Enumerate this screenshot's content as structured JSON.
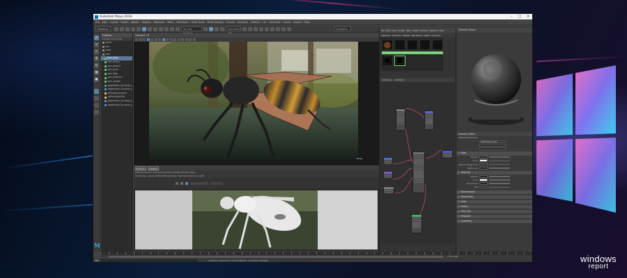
{
  "window": {
    "title": "Autodesk Maya 2018",
    "controls": [
      "–",
      "□",
      "✕"
    ]
  },
  "menubar": [
    "File",
    "Edit",
    "Create",
    "Select",
    "Modify",
    "Display",
    "Windows",
    "Mesh",
    "Edit Mesh",
    "Mesh Tools",
    "Mesh Display",
    "Curves",
    "Surfaces",
    "Deform",
    "UV",
    "Generate",
    "Cache",
    "Arnold",
    "Help"
  ],
  "shelf": {
    "mode": "Modeling",
    "symmetry": "No Live Surface",
    "field_a": "Symmetry: Off",
    "field_b": "Autodesk"
  },
  "outliner": {
    "title": "Outliner",
    "menu": "Display  Show  Help",
    "items": [
      {
        "label": "persp",
        "color": "#8a8a8a"
      },
      {
        "label": "top",
        "color": "#8a8a8a"
      },
      {
        "label": "front",
        "color": "#8a8a8a"
      },
      {
        "label": "side",
        "color": "#8a8a8a"
      },
      {
        "label": "bee_body",
        "color": "#6fbf6f"
      },
      {
        "label": "bee_wing_L",
        "color": "#6fbf6f"
      },
      {
        "label": "bee_wing_R",
        "color": "#6fbf6f"
      },
      {
        "label": "bee_eyes",
        "color": "#6fbf6f"
      },
      {
        "label": "bee_legs",
        "color": "#6fbf6f"
      },
      {
        "label": "bee_antenna",
        "color": "#6fbf6f"
      },
      {
        "label": "bee_stinger",
        "color": "#6fbf6f"
      },
      {
        "label": "Vegetation_Surfaces_grp",
        "color": "#5a8fd0"
      },
      {
        "label": "Vegetation_Surfaces_grp1",
        "color": "#5a8fd0"
      },
      {
        "label": "aiSkyDomeLight1",
        "color": "#d0c25a"
      },
      {
        "label": "defaultLightSet",
        "color": "#d0c25a"
      },
      {
        "label": "Vegetation_Surfaces_grp2",
        "color": "#5a8fd0"
      },
      {
        "label": "Vegetation_Surfaces_grp3",
        "color": "#5a8fd0"
      }
    ]
  },
  "viewport": {
    "title": "Viewport 2.0",
    "menu": "View  Shading  Lighting  Show  Renderer  Panels",
    "camera_label": "persp"
  },
  "hypershade": {
    "title": "Hypershade",
    "menu": [
      "File",
      "Edit",
      "View",
      "Create",
      "Tabs",
      "Graph",
      "Window",
      "Options",
      "Help"
    ],
    "browser_tabs": [
      "Materials",
      "Textures",
      "Utilities",
      "Rendering",
      "Lights",
      "Cameras"
    ],
    "node_editor_tabs": [
      "Untitled_1",
      "Untitled_2"
    ]
  },
  "material_viewer": {
    "title": "Material Viewer",
    "shader": "aiStandardSurface"
  },
  "attribute_editor": {
    "title": "Property Editor",
    "node_type": "aiStandardSurface",
    "node_name": "aiStandard_bee",
    "sections": [
      "Base",
      "Specular",
      "Transmission",
      "Subsurface",
      "Coat",
      "Sheen",
      "Thin Film",
      "Emission",
      "Geometry"
    ],
    "rows": [
      "Weight",
      "Color",
      "Diffuse Roughness",
      "Metalness",
      "Weight",
      "Color",
      "Roughness",
      "IOR"
    ]
  },
  "render": {
    "tabs": [
      "Untitled_1",
      "Untitled_2"
    ],
    "info": "ARNOLD  Render  View  Sample  Frame  Buffer  Window  Help",
    "status": "Rendering...  persp  1920x1080  samples: 3/2/2/2/2  memory: 1.2GB"
  },
  "timeline": {
    "range": "1  120  200"
  },
  "cmdline": {
    "mel": "MEL",
    "result": "// Result: polyCube1 //  Arnold Render: sampling complete"
  },
  "branding": {
    "line1": "windows",
    "line2": "report"
  }
}
